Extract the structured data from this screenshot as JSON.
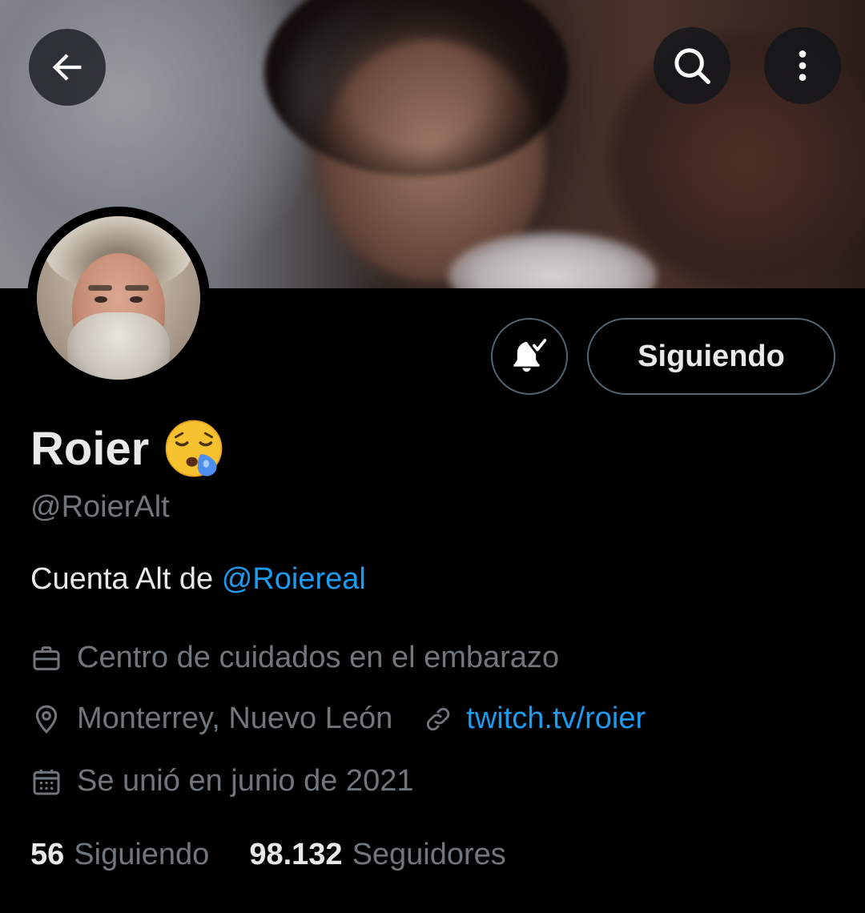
{
  "header": {
    "back_icon": "arrow-left-icon",
    "search_icon": "search-icon",
    "more_icon": "more-vertical-icon"
  },
  "profile": {
    "name": "Roier",
    "name_emoji": "sleepy-face-emoji",
    "handle": "@RoierAlt",
    "bio_prefix": "Cuenta Alt de ",
    "bio_mention": "@Roiereal",
    "category": "Centro de cuidados en el embarazo",
    "location": "Monterrey, Nuevo León",
    "link": "twitch.tv/roier",
    "joined": "Se unió en junio de 2021"
  },
  "actions": {
    "notify_icon": "bell-check-icon",
    "follow_label": "Siguiendo"
  },
  "stats": {
    "following_count": "56",
    "following_label": "Siguiendo",
    "followers_count": "98.132",
    "followers_label": "Seguidores"
  },
  "colors": {
    "background": "#000000",
    "text_primary": "#e7e9ea",
    "text_secondary": "#71767b",
    "accent": "#1d9bf0",
    "border": "#536471"
  }
}
